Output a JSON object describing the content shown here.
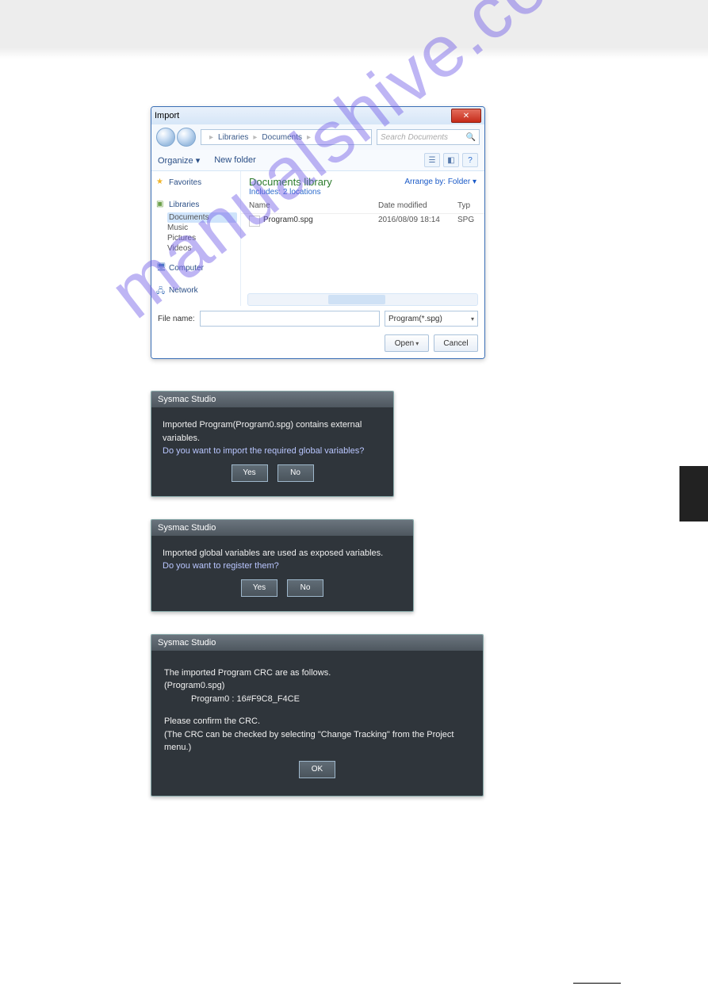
{
  "watermark": "manualshive.com",
  "import_dialog": {
    "title": "Import",
    "path": [
      "",
      "Libraries",
      "Documents"
    ],
    "search_placeholder": "Search Documents",
    "toolbar": {
      "organize": "Organize",
      "new_folder": "New folder"
    },
    "sidebar": {
      "favorites": "Favorites",
      "libraries": "Libraries",
      "items": [
        "Documents",
        "Music",
        "Pictures",
        "Videos"
      ],
      "computer": "Computer",
      "network": "Network"
    },
    "main": {
      "heading": "Documents library",
      "subheading_prefix": "Includes:",
      "subheading_link": "2 locations",
      "arrange_label": "Arrange by:",
      "arrange_value": "Folder",
      "columns": [
        "Name",
        "Date modified",
        "Typ"
      ],
      "rows": [
        {
          "name": "Program0.spg",
          "date": "2016/08/09 18:14",
          "type": "SPG"
        }
      ]
    },
    "footer": {
      "file_name_label": "File name:",
      "file_type": "Program(*.spg)",
      "open": "Open",
      "cancel": "Cancel"
    }
  },
  "dialog_ext_vars": {
    "title": "Sysmac Studio",
    "lines": [
      "Imported Program(Program0.spg) contains external variables.",
      "Do you want to import the required global variables?"
    ],
    "yes": "Yes",
    "no": "No"
  },
  "dialog_exposed": {
    "title": "Sysmac Studio",
    "lines": [
      "Imported global variables are used as exposed variables.",
      "Do you want to register them?"
    ],
    "yes": "Yes",
    "no": "No"
  },
  "dialog_crc": {
    "title": "Sysmac Studio",
    "lines": [
      "The imported Program CRC are as follows.",
      "(Program0.spg)",
      "Program0 : 16#F9C8_F4CE",
      "Please confirm the CRC.",
      "(The CRC can be checked by selecting \"Change Tracking\" from the Project menu.)"
    ],
    "ok": "OK"
  }
}
